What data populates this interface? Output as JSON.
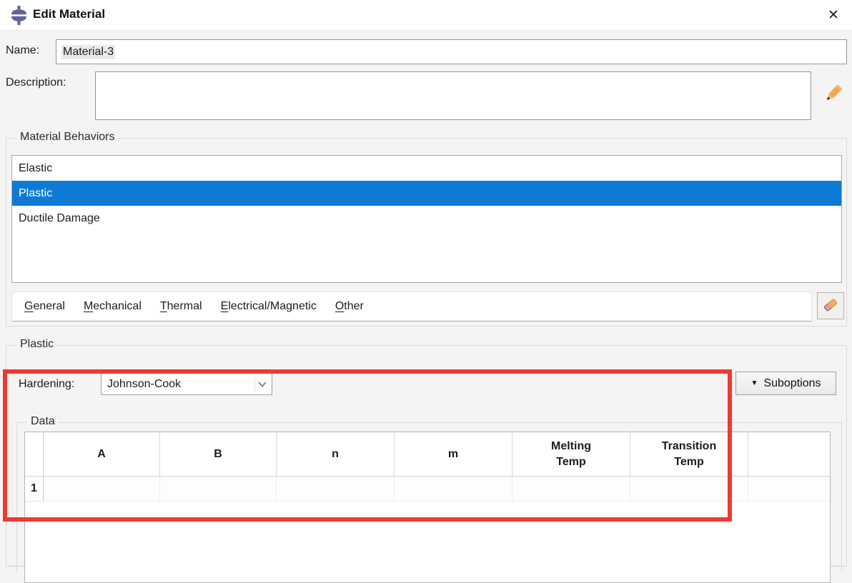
{
  "window": {
    "title": "Edit Material",
    "close_glyph": "✕"
  },
  "fields": {
    "name_label": "Name:",
    "name_value": "Material-3",
    "description_label": "Description:",
    "description_value": ""
  },
  "behaviors": {
    "group_label": "Material Behaviors",
    "items": [
      {
        "label": "Elastic",
        "selected": false
      },
      {
        "label": "Plastic",
        "selected": true
      },
      {
        "label": "Ductile Damage",
        "selected": false
      }
    ]
  },
  "menu": {
    "items": [
      "General",
      "Mechanical",
      "Thermal",
      "Electrical/Magnetic",
      "Other"
    ]
  },
  "plastic": {
    "group_label": "Plastic",
    "hardening_label": "Hardening:",
    "hardening_value": "Johnson-Cook",
    "suboptions_label": "Suboptions",
    "suboptions_arrow": "▼",
    "data_group_label": "Data",
    "table": {
      "columns": [
        "A",
        "B",
        "n",
        "m",
        "Melting\nTemp",
        "Transition\nTemp"
      ],
      "rows": [
        {
          "index": "1",
          "values": [
            "",
            "",
            "",
            "",
            "",
            ""
          ]
        }
      ]
    }
  },
  "colors": {
    "selection_blue": "#0e7ad6",
    "annotation_red": "#ee3a31",
    "icon_purple": "#62629f"
  }
}
